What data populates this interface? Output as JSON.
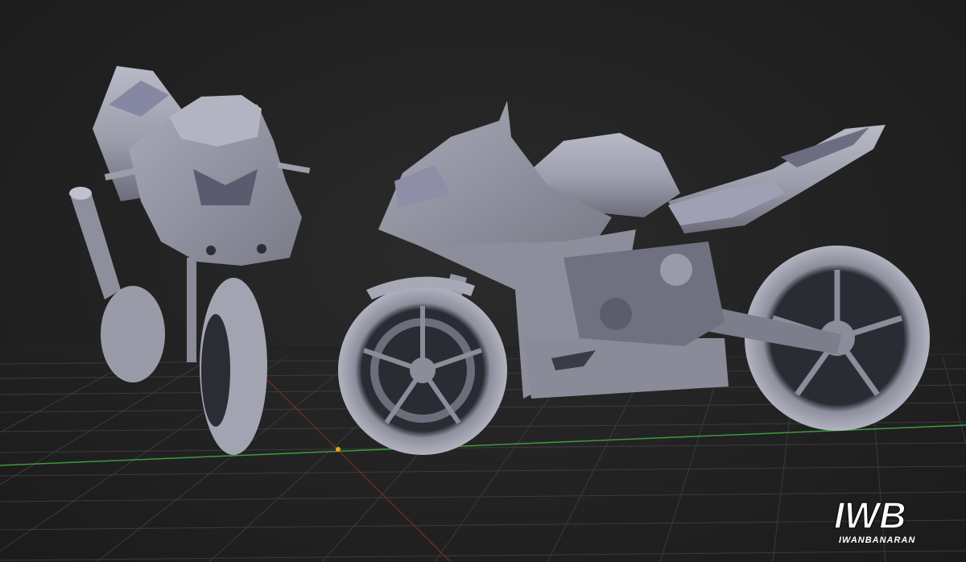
{
  "scene": {
    "description_kind": "3d-viewport-render",
    "background_color": "#232323",
    "grid_color": "#3a3a3a",
    "x_axis_color": "#9a3a3a",
    "y_axis_color": "#3aa03a",
    "model_color": "#a7a8b5",
    "model_shadow_color": "#6f7182",
    "origin_marker_color": "#f0a020"
  },
  "watermark": {
    "logo_text": "IWB",
    "logo_subtext": "IWANBANARAN"
  }
}
